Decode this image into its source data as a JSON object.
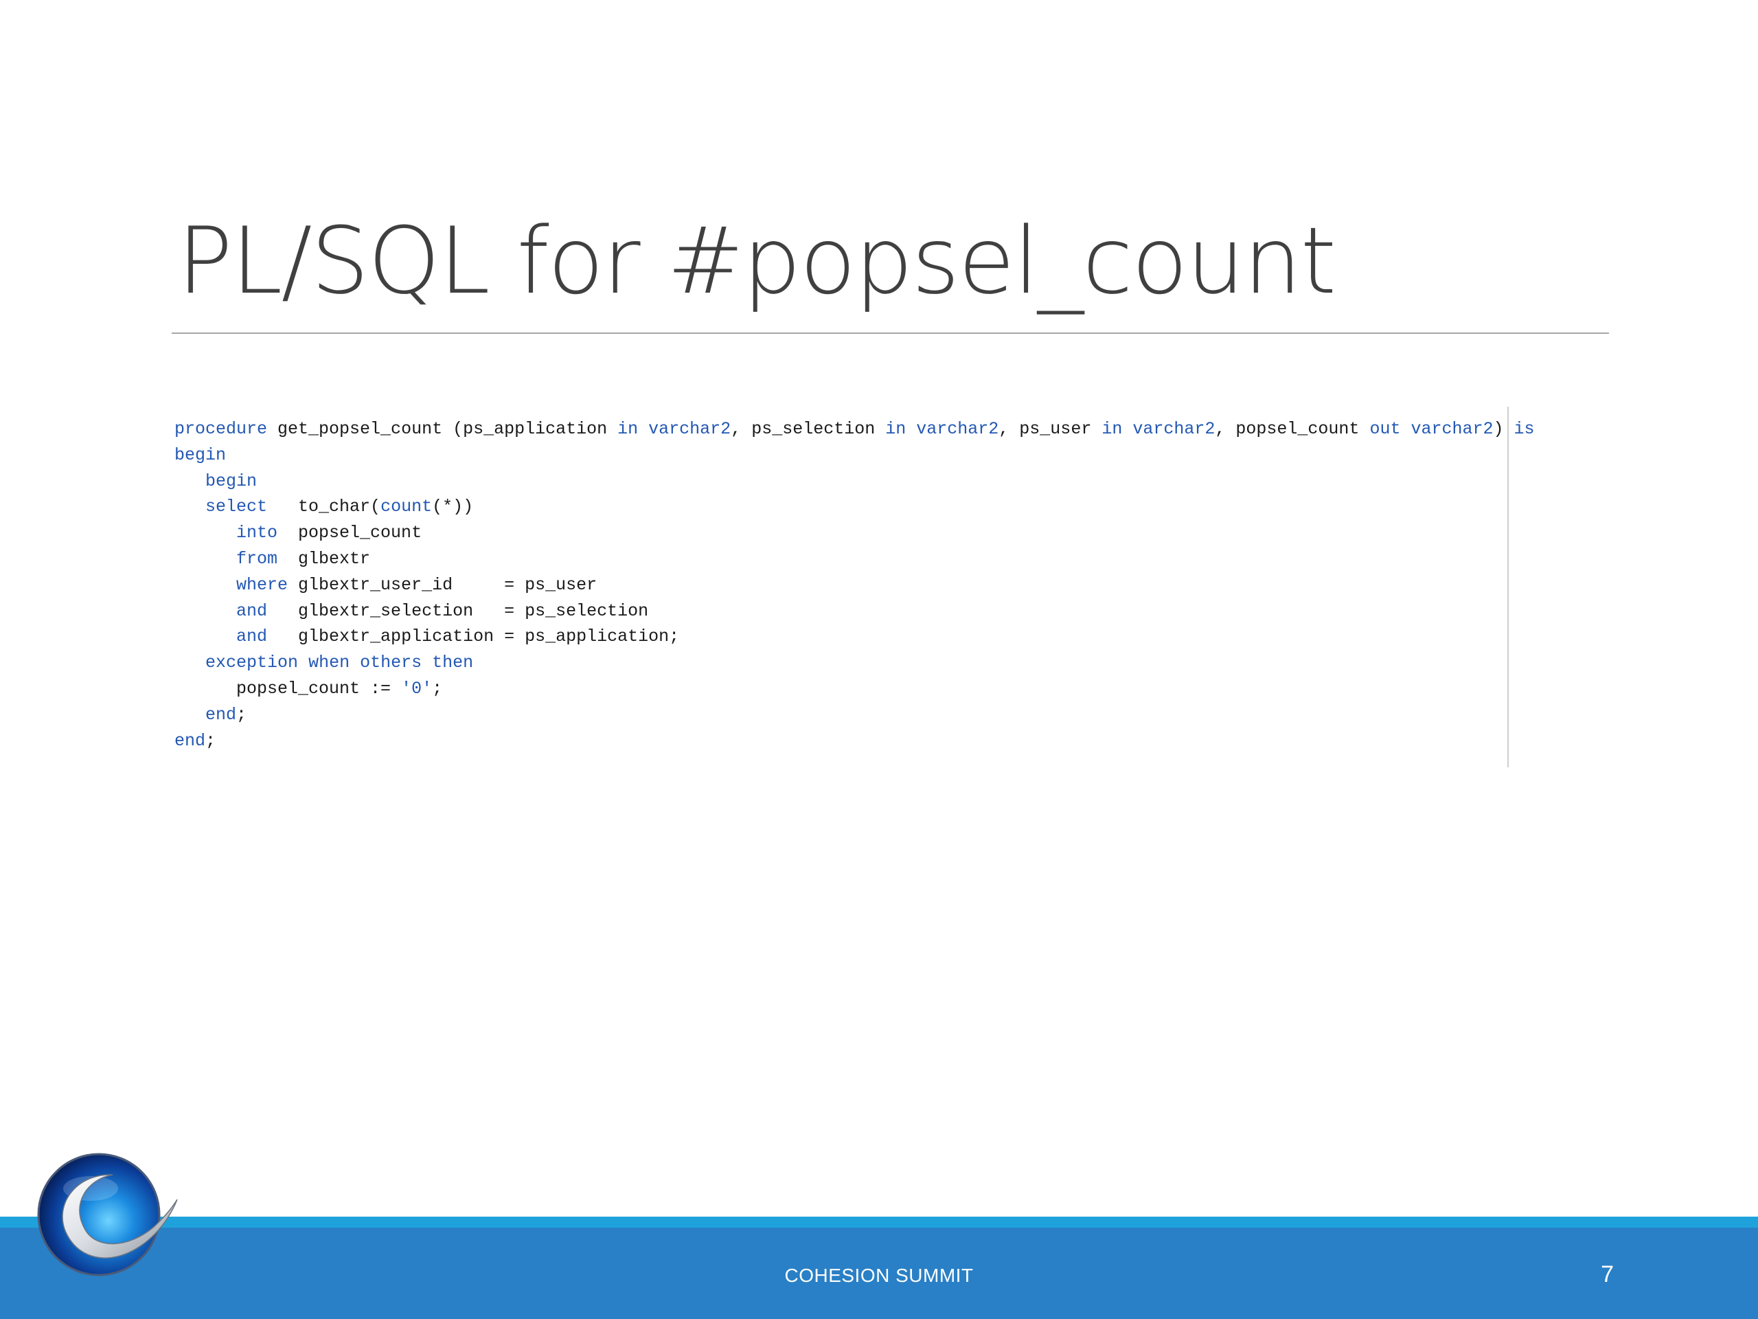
{
  "slide": {
    "title": "PL/SQL for #popsel_count",
    "footer_text": "COHESION SUMMIT",
    "page_number": "7"
  },
  "code": {
    "lines": [
      [
        {
          "t": "procedure",
          "k": true
        },
        {
          "t": " get_popsel_count (ps_application ",
          "k": false
        },
        {
          "t": "in",
          "k": true
        },
        {
          "t": " ",
          "k": false
        },
        {
          "t": "varchar2",
          "k": true
        },
        {
          "t": ", ps_selection ",
          "k": false
        },
        {
          "t": "in",
          "k": true
        },
        {
          "t": " ",
          "k": false
        },
        {
          "t": "varchar2",
          "k": true
        },
        {
          "t": ", ps_user ",
          "k": false
        },
        {
          "t": "in",
          "k": true
        },
        {
          "t": " ",
          "k": false
        },
        {
          "t": "varchar2",
          "k": true
        },
        {
          "t": ", popsel_count ",
          "k": false
        },
        {
          "t": "out",
          "k": true
        },
        {
          "t": " ",
          "k": false
        },
        {
          "t": "varchar2",
          "k": true
        },
        {
          "t": ") ",
          "k": false
        },
        {
          "t": "is",
          "k": true
        }
      ],
      [
        {
          "t": "begin",
          "k": true
        }
      ],
      [
        {
          "t": "   ",
          "k": false
        },
        {
          "t": "begin",
          "k": true
        }
      ],
      [
        {
          "t": "   ",
          "k": false
        },
        {
          "t": "select",
          "k": true
        },
        {
          "t": "   to_char(",
          "k": false
        },
        {
          "t": "count",
          "k": true
        },
        {
          "t": "(*))",
          "k": false
        }
      ],
      [
        {
          "t": "      ",
          "k": false
        },
        {
          "t": "into",
          "k": true
        },
        {
          "t": "  popsel_count",
          "k": false
        }
      ],
      [
        {
          "t": "      ",
          "k": false
        },
        {
          "t": "from",
          "k": true
        },
        {
          "t": "  glbextr",
          "k": false
        }
      ],
      [
        {
          "t": "      ",
          "k": false
        },
        {
          "t": "where",
          "k": true
        },
        {
          "t": " glbextr_user_id     = ps_user",
          "k": false
        }
      ],
      [
        {
          "t": "      ",
          "k": false
        },
        {
          "t": "and",
          "k": true
        },
        {
          "t": "   glbextr_selection   = ps_selection",
          "k": false
        }
      ],
      [
        {
          "t": "      ",
          "k": false
        },
        {
          "t": "and",
          "k": true
        },
        {
          "t": "   glbextr_application = ps_application;",
          "k": false
        }
      ],
      [
        {
          "t": "   ",
          "k": false
        },
        {
          "t": "exception",
          "k": true
        },
        {
          "t": " ",
          "k": false
        },
        {
          "t": "when",
          "k": true
        },
        {
          "t": " ",
          "k": false
        },
        {
          "t": "others",
          "k": true
        },
        {
          "t": " ",
          "k": false
        },
        {
          "t": "then",
          "k": true
        }
      ],
      [
        {
          "t": "      popsel_count := ",
          "k": false
        },
        {
          "t": "'0'",
          "k": true
        },
        {
          "t": ";",
          "k": false
        }
      ],
      [
        {
          "t": "   ",
          "k": false
        },
        {
          "t": "end",
          "k": true
        },
        {
          "t": ";",
          "k": false
        }
      ],
      [
        {
          "t": "end",
          "k": true
        },
        {
          "t": ";",
          "k": false
        }
      ]
    ]
  },
  "colors": {
    "keyword": "#2358b3",
    "text": "#1a1a1a",
    "title": "#404040",
    "footer_band": "#2980c6",
    "footer_stripe": "#1fa2dc"
  },
  "icons": {
    "logo": "globe-swoosh-logo"
  }
}
